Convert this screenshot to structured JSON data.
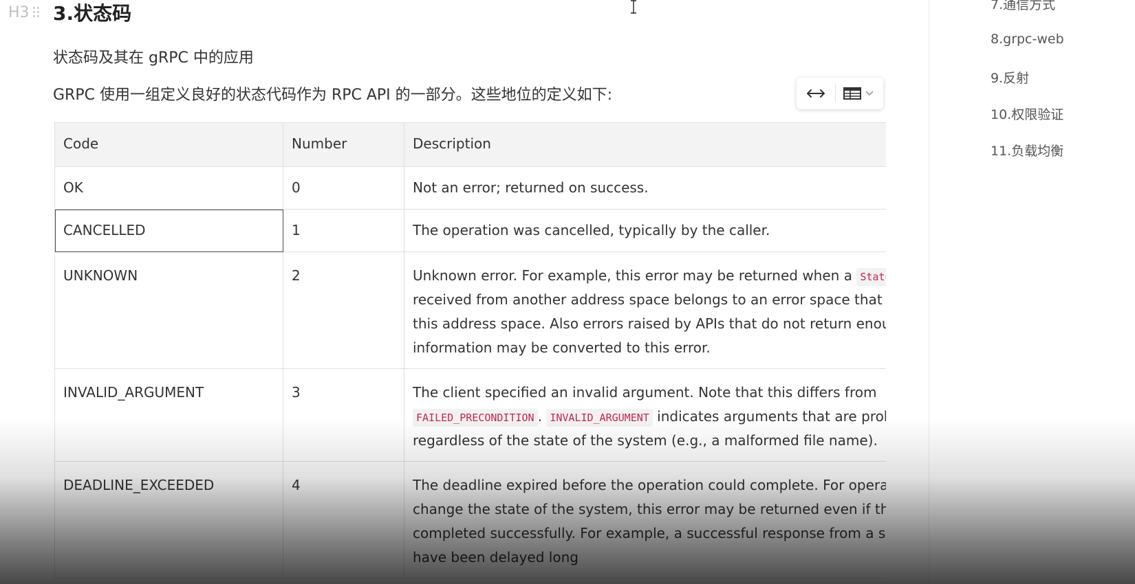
{
  "heading": {
    "marker": "H3",
    "title": "3.状态码"
  },
  "paragraphs": [
    "状态码及其在 gRPC 中的应用",
    "GRPC 使用一组定义良好的状态代码作为 RPC API 的一部分。这些地位的定义如下:"
  ],
  "table_toolbar": {
    "width_icon": "arrows-horizontal-icon",
    "table_icon": "table-icon"
  },
  "table": {
    "headers": [
      "Code",
      "Number",
      "Description"
    ],
    "rows": [
      {
        "code": "OK",
        "number": "0",
        "description": "Not an error; returned on success."
      },
      {
        "code": "CANCELLED",
        "number": "1",
        "description": "The operation was cancelled, typically by the caller."
      },
      {
        "code": "UNKNOWN",
        "number": "2",
        "desc_line1": "Unknown error. For example, this error may be returned when a ",
        "desc_code1": "Status",
        "desc_line2": "received from another address space belongs to an error space that is",
        "desc_line3": "this address space. Also errors raised by APIs that do not return enough",
        "desc_line4": "information may be converted to this error."
      },
      {
        "code": "INVALID_ARGUMENT",
        "number": "3",
        "desc_line1": "The client specified an invalid argument. Note that this differs from ",
        "desc_code1": "FAILED_PRECONDITION",
        "desc_sep": ". ",
        "desc_code2": "INVALID_ARGUMENT",
        "desc_line2_tail": " indicates arguments that are problematic",
        "desc_line3": "regardless of the state of the system (e.g., a malformed file name)."
      },
      {
        "code": "DEADLINE_EXCEEDED",
        "number": "4",
        "desc_line1": "The deadline expired before the operation could complete. For operations",
        "desc_line2": "change the state of the system, this error may be returned even if the operation",
        "desc_line3": "completed successfully. For example, a successful response from a server could",
        "desc_line4": "have been delayed long"
      }
    ]
  },
  "outline": {
    "items": [
      "7.通信方式",
      "8.grpc-web",
      "9.反射",
      "10.权限验证",
      "11.负载均衡"
    ]
  }
}
